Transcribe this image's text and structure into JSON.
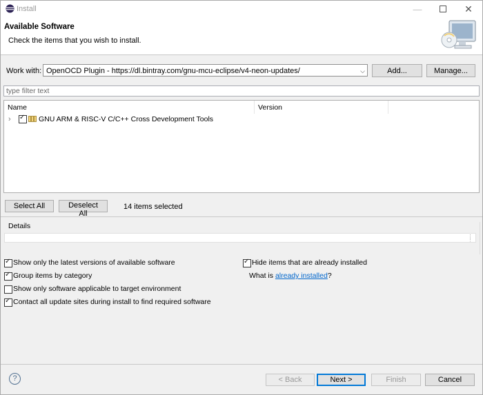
{
  "window": {
    "title": "Install",
    "minimize_icon": "minimize-icon",
    "maximize_icon": "maximize-icon",
    "close_icon": "close-icon"
  },
  "banner": {
    "title": "Available Software",
    "description": "Check the items that you wish to install."
  },
  "work_with": {
    "label": "Work with:",
    "value": "OpenOCD Plugin - https://dl.bintray.com/gnu-mcu-eclipse/v4-neon-updates/",
    "add_label": "Add...",
    "manage_label": "Manage..."
  },
  "filter": {
    "placeholder": "type filter text"
  },
  "tree": {
    "columns": [
      "Name",
      "Version"
    ],
    "items": [
      {
        "label": "GNU ARM & RISC-V C/C++ Cross Development Tools",
        "checked": true,
        "expanded": false
      }
    ]
  },
  "selection": {
    "select_all_label": "Select All",
    "deselect_all_label": "Deselect All",
    "status": "14 items selected"
  },
  "details": {
    "label": "Details"
  },
  "options": {
    "latest_versions": {
      "label": "Show only the latest versions of available software",
      "checked": true
    },
    "hide_installed": {
      "label": "Hide items that are already installed",
      "checked": true
    },
    "group_by_category": {
      "label": "Group items by category",
      "checked": true
    },
    "what_is_prefix": "What is ",
    "what_is_link": "already installed",
    "what_is_suffix": "?",
    "target_env": {
      "label": "Show only software applicable to target environment",
      "checked": false
    },
    "contact_sites": {
      "label": "Contact all update sites during install to find required software",
      "checked": true
    }
  },
  "footer": {
    "help_glyph": "?",
    "back_label": "< Back",
    "next_label": "Next >",
    "finish_label": "Finish",
    "cancel_label": "Cancel"
  },
  "colors": {
    "link": "#0066cc",
    "default_button_border": "#0078d7",
    "dialog_background": "#f0f0f0"
  }
}
